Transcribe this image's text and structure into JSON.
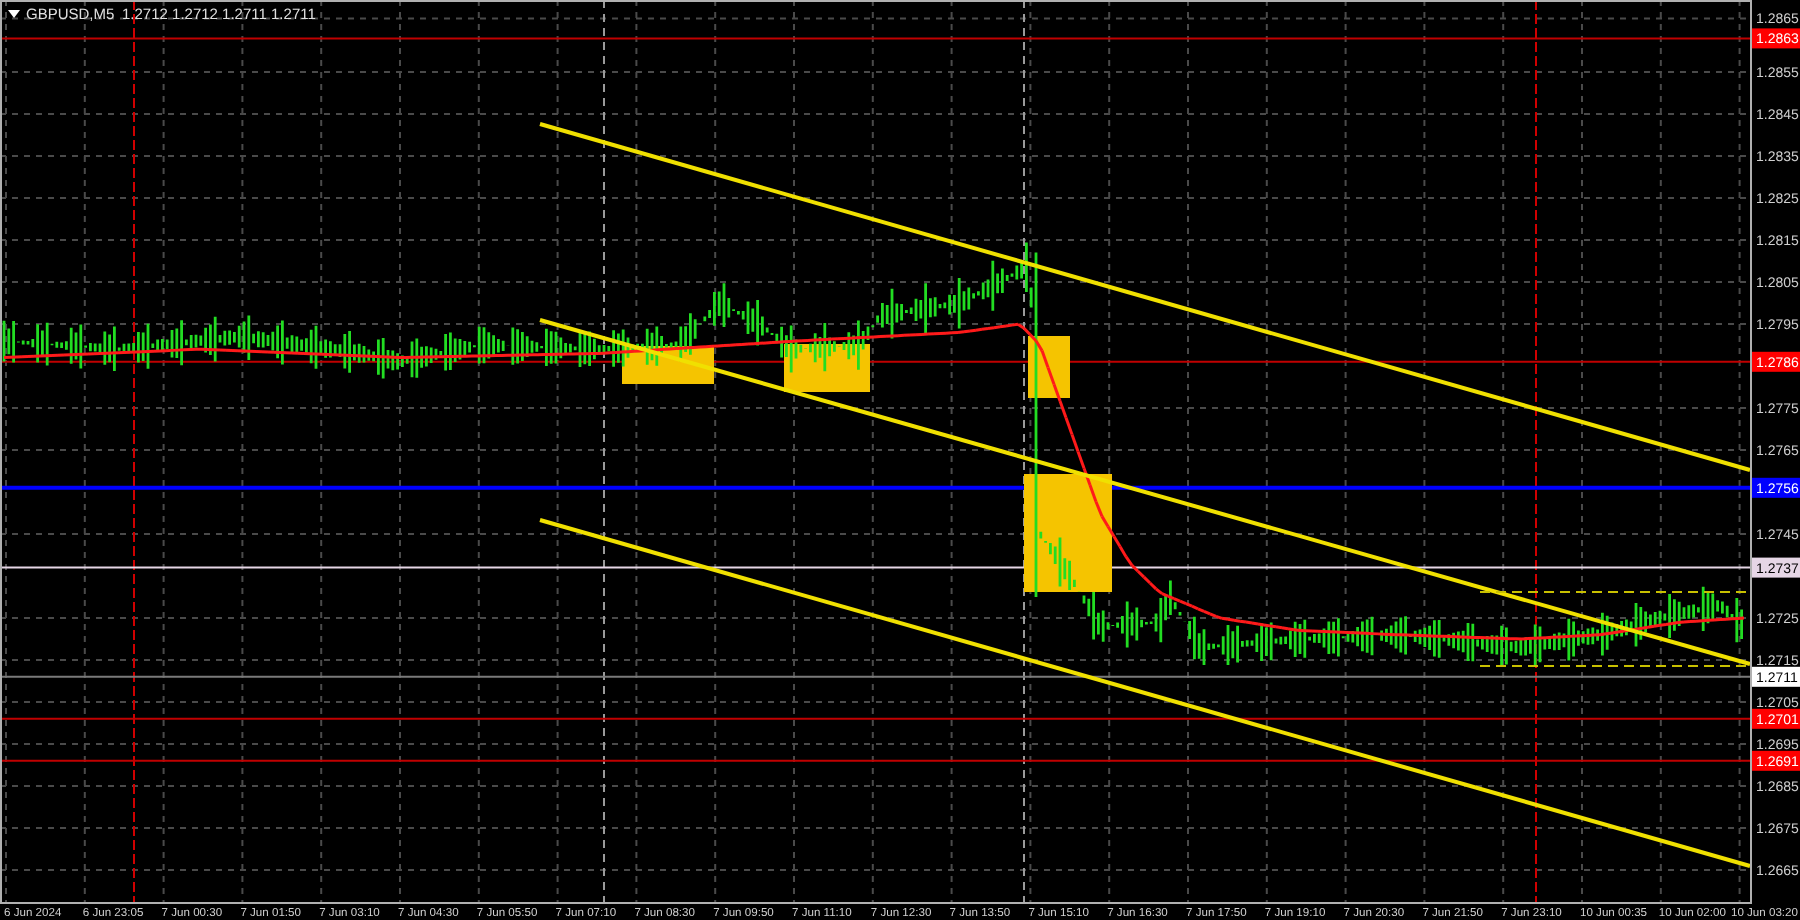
{
  "title": {
    "symbol": "GBPUSD,M5",
    "quotes": [
      "1.2712",
      "1.2712",
      "1.2711",
      "1.2711"
    ]
  },
  "price_axis": {
    "ticks": [
      "1.2865",
      "1.2855",
      "1.2845",
      "1.2835",
      "1.2825",
      "1.2815",
      "1.2805",
      "1.2795",
      "1.2775",
      "1.2765",
      "1.2745",
      "1.2725",
      "1.2715",
      "1.2705",
      "1.2695",
      "1.2685",
      "1.2675",
      "1.2665"
    ],
    "levels": [
      {
        "label": "1.2863",
        "color": "#ff0000"
      },
      {
        "label": "1.2786",
        "color": "#ff0000"
      },
      {
        "label": "1.2756",
        "color": "#0000ff"
      },
      {
        "label": "1.2737",
        "color": "#e6d6e6"
      },
      {
        "label": "1.2711",
        "color": "#ffffff"
      },
      {
        "label": "1.2701",
        "color": "#ff0000"
      },
      {
        "label": "1.2691",
        "color": "#ff0000"
      }
    ]
  },
  "time_axis": {
    "labels": [
      "6 Jun 2024",
      "6 Jun 23:05",
      "7 Jun 00:30",
      "7 Jun 01:50",
      "7 Jun 03:10",
      "7 Jun 04:30",
      "7 Jun 05:50",
      "7 Jun 07:10",
      "7 Jun 08:30",
      "7 Jun 09:50",
      "7 Jun 11:10",
      "7 Jun 12:30",
      "7 Jun 13:50",
      "7 Jun 15:10",
      "7 Jun 16:30",
      "7 Jun 17:50",
      "7 Jun 19:10",
      "7 Jun 20:30",
      "7 Jun 21:50",
      "7 Jun 23:10",
      "10 Jun 00:35",
      "10 Jun 02:00",
      "10 Jun 03:20"
    ]
  }
}
